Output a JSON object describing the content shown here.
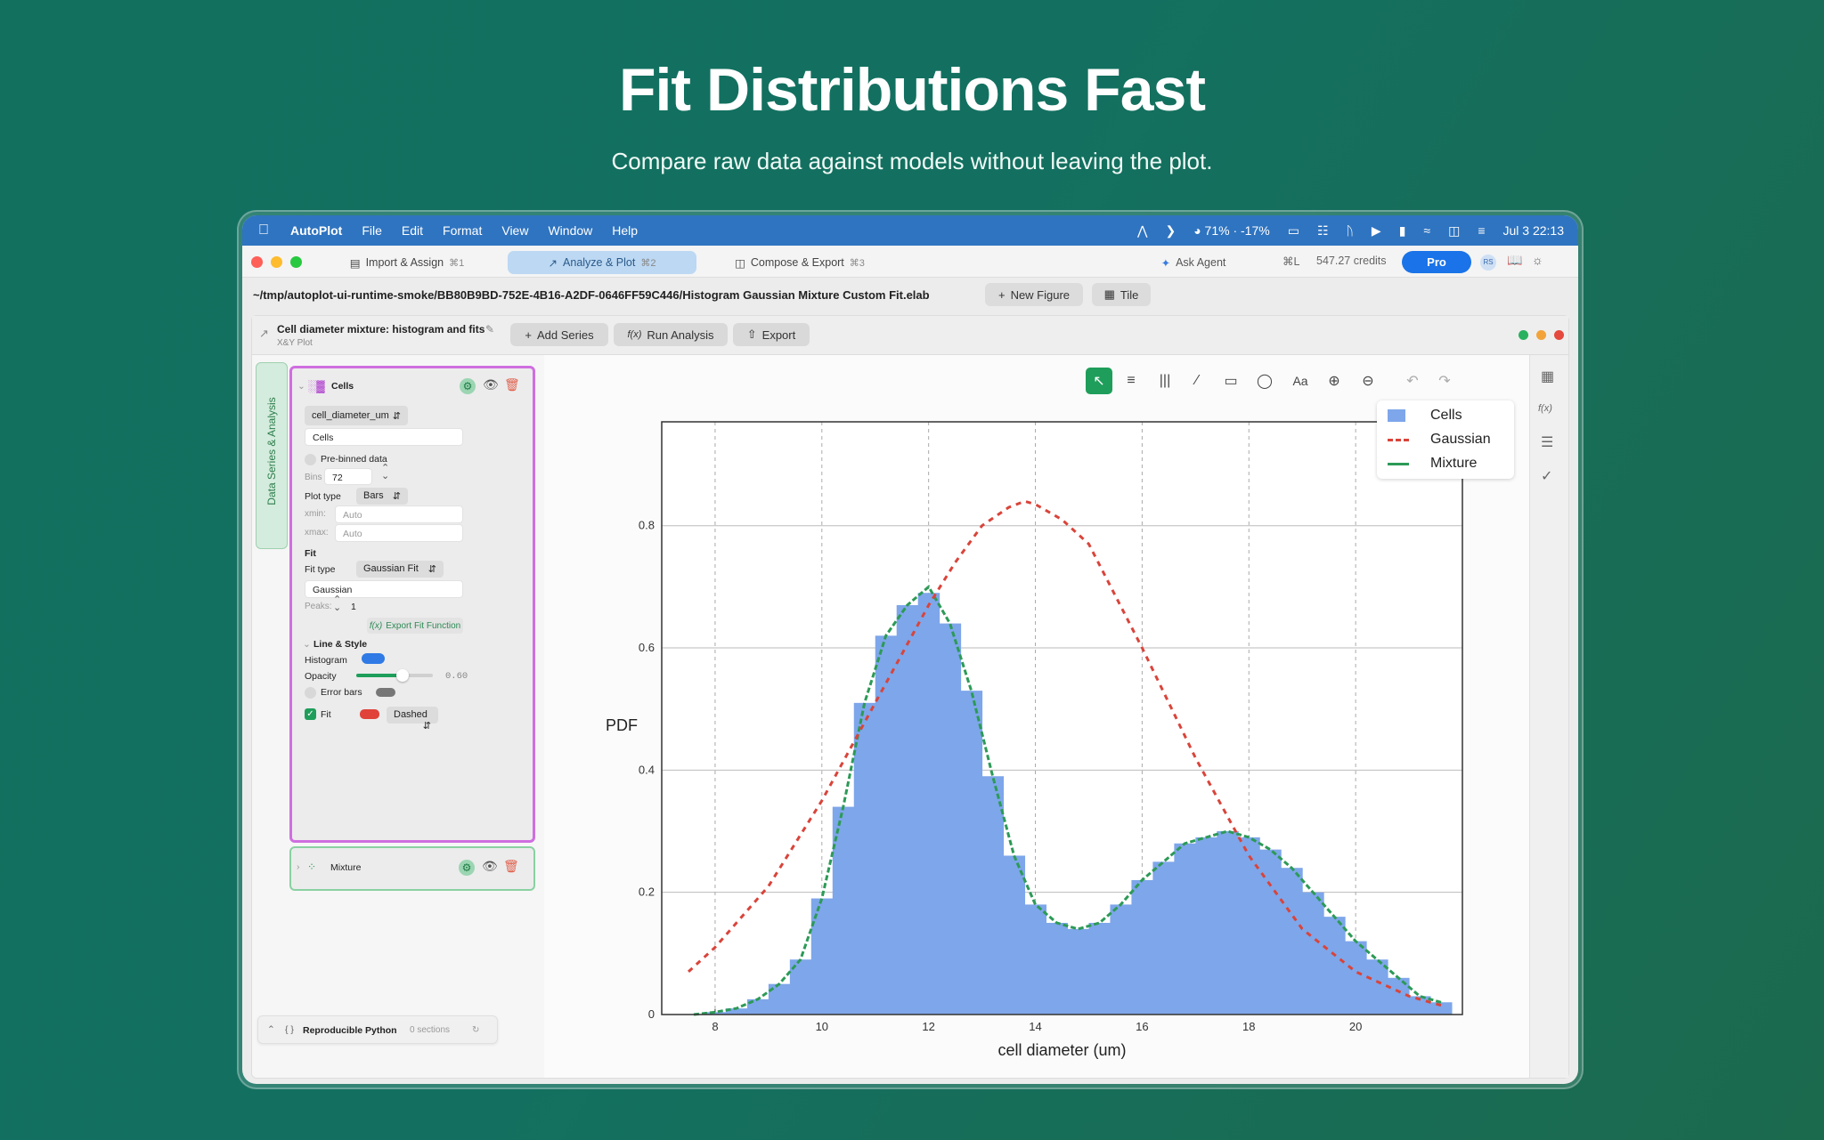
{
  "hero": {
    "title": "Fit Distributions Fast",
    "subtitle": "Compare raw data against models without leaving the plot."
  },
  "menubar": {
    "app": "AutoPlot",
    "items": [
      "File",
      "Edit",
      "Format",
      "View",
      "Window",
      "Help"
    ],
    "battery": "71% · -17%",
    "datetime": "Jul 3  22:13"
  },
  "tabs": [
    {
      "label": "Import & Assign",
      "shortcut": "⌘1"
    },
    {
      "label": "Analyze & Plot",
      "shortcut": "⌘2"
    },
    {
      "label": "Compose & Export",
      "shortcut": "⌘3"
    }
  ],
  "agent": {
    "label": "Ask Agent",
    "shortcut": "⌘L",
    "credits": "547.27 credits",
    "plan": "Pro",
    "avatar": "RS"
  },
  "pathbar": {
    "path": "~/tmp/autoplot-ui-runtime-smoke/BB80B9BD-752E-4B16-A2DF-0646FF59C446/Histogram Gaussian Mixture Custom Fit.elab",
    "new_figure": "New Figure",
    "tile": "Tile"
  },
  "document": {
    "title": "Cell diameter mixture: histogram and fits",
    "subtitle": "X&Y Plot",
    "add_series": "Add Series",
    "run_analysis": "Run Analysis",
    "export": "Export"
  },
  "sidebar_tab": "Data Series & Analysis",
  "series_panel": {
    "name": "Cells",
    "column": "cell_diameter_um",
    "label_value": "Cells",
    "prebinned": "Pre-binned data",
    "bins_label": "Bins",
    "bins_value": "72",
    "plot_type_label": "Plot type",
    "plot_type": "Bars",
    "xmin_label": "xmin:",
    "xmin_placeholder": "Auto",
    "xmax_label": "xmax:",
    "xmax_placeholder": "Auto",
    "fit_section": "Fit",
    "fit_type_label": "Fit type",
    "fit_type": "Gaussian Fit",
    "fit_name": "Gaussian",
    "peaks_label": "Peaks:",
    "peaks_value": "1",
    "export_fit": "Export Fit Function",
    "line_style": "Line & Style",
    "histogram_label": "Histogram",
    "opacity_label": "Opacity",
    "opacity_value": "0.60",
    "opacity_fraction": 0.6,
    "error_bars_label": "Error bars",
    "fit_label": "Fit",
    "fit_style": "Dashed"
  },
  "series2": {
    "name": "Mixture"
  },
  "python_footer": {
    "label": "Reproducible Python",
    "sections": "0 sections"
  },
  "colors": {
    "histogram": "#7ea6ea",
    "gaussian": "#d9443a",
    "mixture": "#2c9a56",
    "accent": "#1e9e5a",
    "panel_border": "#cf6ee0"
  },
  "chart_data": {
    "type": "bar",
    "xlabel": "cell diameter (um)",
    "ylabel": "PDF",
    "xlim": [
      7,
      22
    ],
    "ylim": [
      0,
      0.97
    ],
    "xticks": [
      8,
      10,
      12,
      14,
      16,
      18,
      20
    ],
    "yticks": [
      0,
      0.2,
      0.4,
      0.6,
      0.8
    ],
    "legend_position": "top-right",
    "grid": true,
    "series": [
      {
        "name": "Cells",
        "kind": "histogram",
        "x": [
          7.6,
          8.0,
          8.4,
          8.8,
          9.2,
          9.6,
          10.0,
          10.4,
          10.8,
          11.2,
          11.6,
          12.0,
          12.4,
          12.8,
          13.2,
          13.6,
          14.0,
          14.4,
          14.8,
          15.2,
          15.6,
          16.0,
          16.4,
          16.8,
          17.2,
          17.6,
          18.0,
          18.4,
          18.8,
          19.2,
          19.6,
          20.0,
          20.4,
          20.8,
          21.2,
          21.6
        ],
        "values": [
          0.0,
          0.004,
          0.01,
          0.025,
          0.05,
          0.09,
          0.19,
          0.34,
          0.51,
          0.62,
          0.67,
          0.69,
          0.64,
          0.53,
          0.39,
          0.26,
          0.18,
          0.15,
          0.14,
          0.15,
          0.18,
          0.22,
          0.25,
          0.28,
          0.29,
          0.3,
          0.29,
          0.27,
          0.24,
          0.2,
          0.16,
          0.12,
          0.09,
          0.06,
          0.03,
          0.02
        ]
      },
      {
        "name": "Gaussian",
        "kind": "line",
        "x": [
          7.5,
          8.0,
          9.0,
          10.0,
          11.0,
          12.0,
          12.5,
          13.0,
          13.5,
          13.8,
          14.0,
          14.5,
          15.0,
          16.0,
          17.0,
          18.0,
          19.0,
          20.0,
          21.0,
          21.6
        ],
        "values": [
          0.07,
          0.11,
          0.21,
          0.35,
          0.51,
          0.67,
          0.74,
          0.8,
          0.83,
          0.84,
          0.835,
          0.81,
          0.77,
          0.6,
          0.42,
          0.26,
          0.14,
          0.07,
          0.03,
          0.015
        ]
      },
      {
        "name": "Mixture",
        "kind": "line",
        "x": [
          7.6,
          8.0,
          8.4,
          8.8,
          9.2,
          9.6,
          10.0,
          10.4,
          10.8,
          11.2,
          11.6,
          12.0,
          12.4,
          12.8,
          13.2,
          13.6,
          14.0,
          14.4,
          14.8,
          15.2,
          15.6,
          16.0,
          16.4,
          16.8,
          17.2,
          17.6,
          18.0,
          18.4,
          18.8,
          19.2,
          19.6,
          20.0,
          20.4,
          20.8,
          21.2,
          21.6
        ],
        "values": [
          0.0,
          0.004,
          0.01,
          0.025,
          0.05,
          0.09,
          0.19,
          0.34,
          0.51,
          0.62,
          0.67,
          0.7,
          0.64,
          0.53,
          0.39,
          0.26,
          0.18,
          0.15,
          0.14,
          0.15,
          0.18,
          0.22,
          0.25,
          0.28,
          0.29,
          0.3,
          0.29,
          0.27,
          0.24,
          0.2,
          0.16,
          0.12,
          0.09,
          0.06,
          0.03,
          0.02
        ]
      }
    ]
  }
}
